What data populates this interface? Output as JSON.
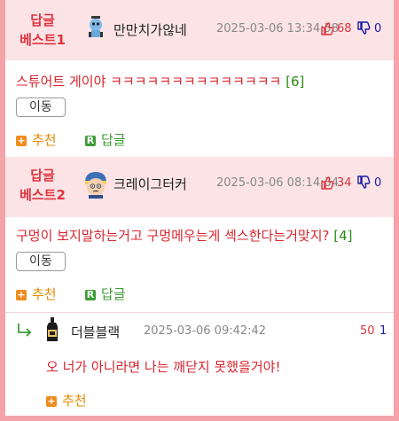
{
  "comments": [
    {
      "best_label_line1": "답글",
      "best_label_line2": "베스트1",
      "nick": "만만치가않네",
      "time": "2025-03-06 13:34:58",
      "up": "68",
      "down": "0",
      "text": "스튜어트 게이야 ㅋㅋㅋㅋㅋㅋㅋㅋㅋㅋㅋㅋㅋㅋ",
      "reply_count": "[6]",
      "move_label": "이동",
      "recommend_label": "추천",
      "reply_label": "답글"
    },
    {
      "best_label_line1": "답글",
      "best_label_line2": "베스트2",
      "nick": "크레이그터커",
      "time": "2025-03-06 08:14:34",
      "up": "34",
      "down": "0",
      "text": "구멍이 보지말하는거고 구멍메우는게 섹스한다는거맞지?",
      "reply_count": "[4]",
      "move_label": "이동",
      "recommend_label": "추천",
      "reply_label": "답글"
    }
  ],
  "reply": {
    "nick": "더블블랙",
    "time": "2025-03-06 09:42:42",
    "up": "50",
    "down": "1",
    "text": "오 너가 아니라면 나는 깨닫지 못했을거야!",
    "recommend_label": "추천"
  },
  "icons": {
    "thumb_up": "thumb-up-icon",
    "thumb_down": "thumb-down-icon",
    "plus": "plus-icon",
    "reply_badge": "reply-badge-icon",
    "reply_arrow": "reply-arrow-icon"
  },
  "colors": {
    "frame": "#f4a3a8",
    "best_bg": "#fbe3e6",
    "best_label": "#e0343e",
    "body_text": "#d7262f",
    "action": "#e68a00",
    "reply_green": "#3d9b36",
    "down_blue": "#1a1aa6"
  }
}
